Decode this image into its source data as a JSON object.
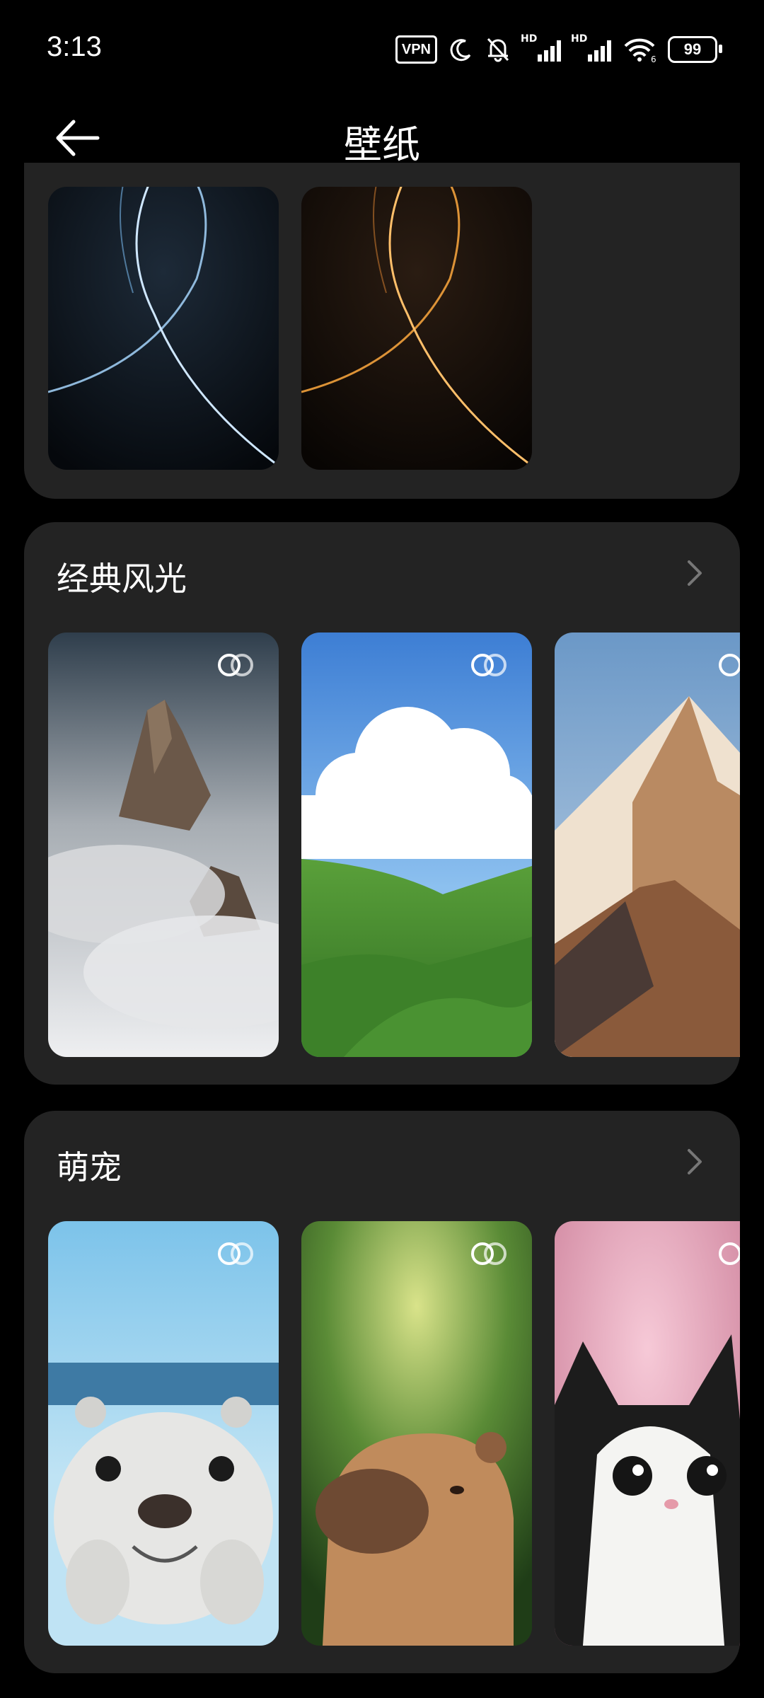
{
  "status": {
    "time": "3:13",
    "vpn": "VPN",
    "hd1": "HD",
    "hd2": "HD",
    "battery": "99",
    "wifi_sub": "6"
  },
  "header": {
    "title": "壁纸"
  },
  "sections": [
    {
      "title": "经典风光"
    },
    {
      "title": "萌宠"
    }
  ],
  "colors": {
    "background": "#000000",
    "card": "#232323"
  },
  "icons": [
    "back-arrow-icon",
    "chevron-right-icon",
    "dual-circle-icon",
    "vpn-icon",
    "moon-icon",
    "mute-bell-icon",
    "signal-icon",
    "wifi-icon",
    "battery-icon"
  ]
}
